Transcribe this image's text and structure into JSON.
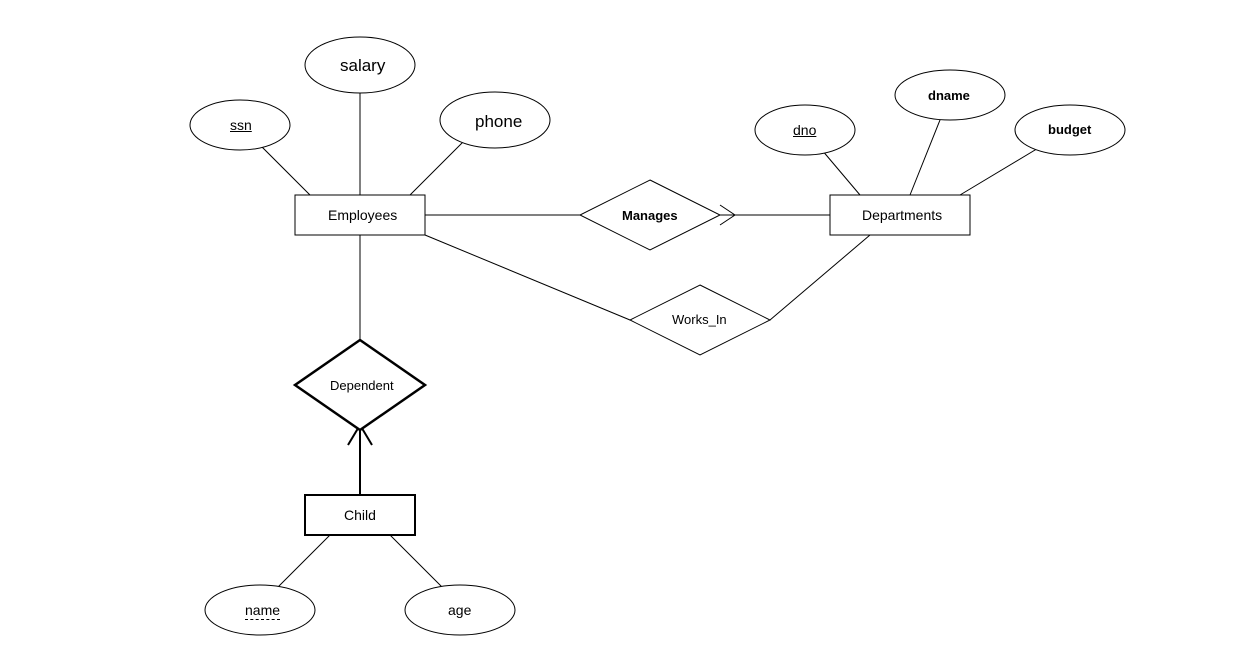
{
  "entities": {
    "employees": {
      "label": "Employees"
    },
    "departments": {
      "label": "Departments"
    },
    "child": {
      "label": "Child"
    }
  },
  "relationships": {
    "manages": {
      "label": "Manages"
    },
    "works_in": {
      "label": "Works_In"
    },
    "dependent": {
      "label": "Dependent"
    }
  },
  "attributes": {
    "ssn": {
      "label": "ssn",
      "key": true
    },
    "salary": {
      "label": "salary"
    },
    "phone": {
      "label": "phone"
    },
    "dno": {
      "label": "dno",
      "key": true
    },
    "dname": {
      "label": "dname"
    },
    "budget": {
      "label": "budget"
    },
    "name": {
      "label": "name",
      "partial_key": true
    },
    "age": {
      "label": "age"
    }
  }
}
